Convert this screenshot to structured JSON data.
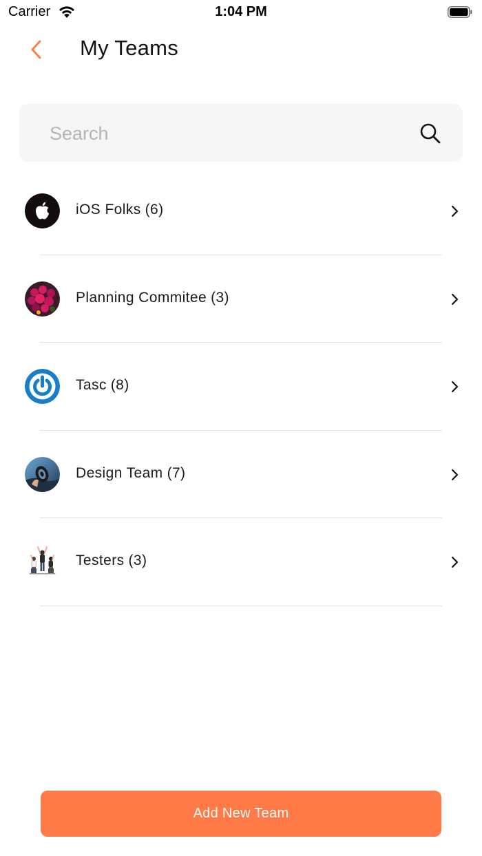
{
  "status_bar": {
    "carrier": "Carrier",
    "time": "1:04 PM"
  },
  "header": {
    "title": "My Teams",
    "back_icon": "chevron-left-icon"
  },
  "search": {
    "placeholder": "Search",
    "value": "",
    "icon": "search-icon"
  },
  "teams": [
    {
      "name": "iOS Folks",
      "count": "(6)",
      "avatar": "apple-logo"
    },
    {
      "name": "Planning Commitee",
      "count": "(3)",
      "avatar": "flowers-photo"
    },
    {
      "name": "Tasc",
      "count": "(8)",
      "avatar": "power-logo"
    },
    {
      "name": "Design Team",
      "count": "(7)",
      "avatar": "camera-lens-photo"
    },
    {
      "name": "Testers",
      "count": "(3)",
      "avatar": "group-celebrating-illustration"
    }
  ],
  "footer": {
    "add_button_label": "Add New Team"
  },
  "colors": {
    "accent": "#ff7a47",
    "search_bg": "#f6f6f6",
    "divider": "#e2e2e2",
    "placeholder": "#b5b5b5"
  }
}
